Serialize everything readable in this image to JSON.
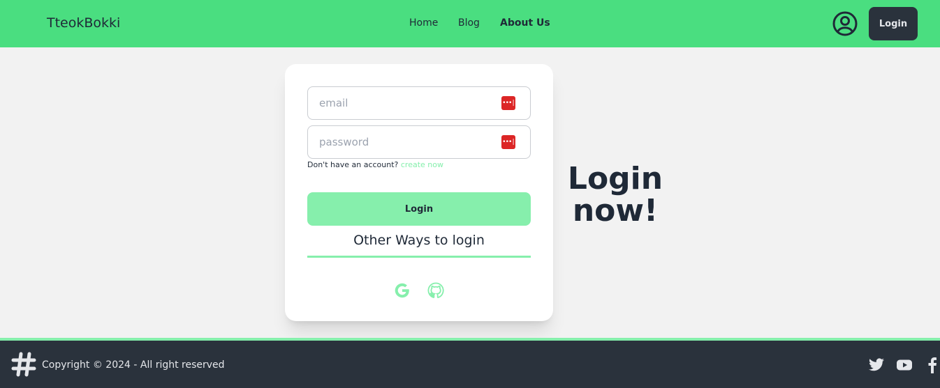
{
  "navbar": {
    "brand": "TteokBokki",
    "links": [
      {
        "label": "Home"
      },
      {
        "label": "Blog"
      },
      {
        "label": "About Us"
      }
    ],
    "user_icon": "user-circle-icon",
    "login_label": "Login"
  },
  "login_form": {
    "email_placeholder": "email",
    "password_placeholder": "password",
    "password_manager_icon": "password-manager-icon",
    "signup_prompt": "Don't have an account?",
    "signup_link": "create now",
    "login_label": "Login",
    "other_ways": "Other Ways to login",
    "social_icons": [
      "google-icon",
      "github-icon"
    ]
  },
  "hero": {
    "line1": "Login",
    "line2": "now!"
  },
  "footer": {
    "copyright": "Copyright © 2024 - All right reserved",
    "logo_icon": "hashtag-logo-icon",
    "social_icons": [
      "twitter-icon",
      "youtube-icon",
      "facebook-icon"
    ]
  },
  "colors": {
    "nav_bg": "#4ade80",
    "accent": "#86efac",
    "dark": "#2a323c",
    "text": "#1f2937",
    "password_icon": "#dc2626"
  }
}
